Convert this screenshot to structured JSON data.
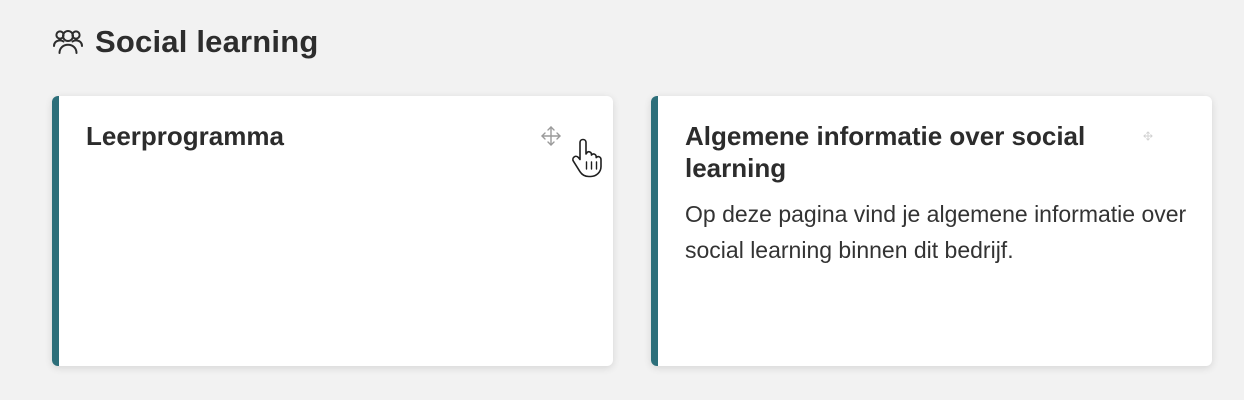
{
  "section": {
    "icon": "users-group-icon",
    "title": "Social learning"
  },
  "cards": [
    {
      "title": "Leerprogramma",
      "description": "",
      "handle_icon": "move-icon"
    },
    {
      "title": "Algemene informatie over social learning",
      "description": "Op deze pagina vind je algemene informatie over social learning binnen dit bedrijf.",
      "handle_icon": "move-icon"
    }
  ],
  "colors": {
    "accent": "#2d6f7a",
    "background": "#f2f2f2",
    "card": "#ffffff"
  },
  "cursor_icon": "hand-pointer-icon"
}
